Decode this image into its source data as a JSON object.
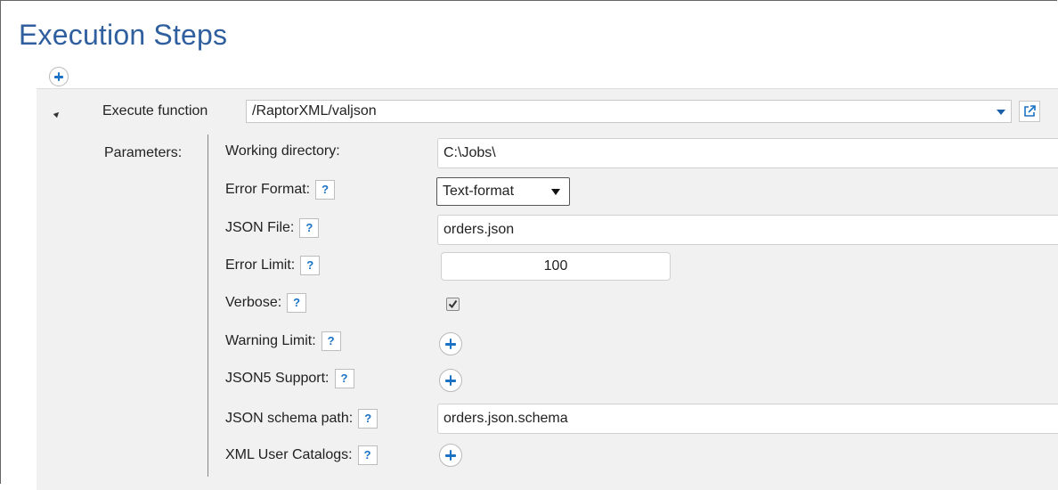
{
  "header": {
    "title": "Execution Steps"
  },
  "step": {
    "execute_label": "Execute function",
    "execute_value": "/RaptorXML/valjson",
    "parameters_label": "Parameters:"
  },
  "params": {
    "working_directory": {
      "label": "Working directory:",
      "value": "C:\\Jobs\\"
    },
    "error_format": {
      "label": "Error Format:",
      "value": "Text-format"
    },
    "json_file": {
      "label": "JSON File:",
      "value": "orders.json"
    },
    "error_limit": {
      "label": "Error Limit:",
      "value": "100"
    },
    "verbose": {
      "label": "Verbose:",
      "checked": true
    },
    "warning_limit": {
      "label": "Warning Limit:"
    },
    "json5_support": {
      "label": "JSON5 Support:"
    },
    "json_schema_path": {
      "label": "JSON schema path:",
      "value": "orders.json.schema"
    },
    "xml_user_catalogs": {
      "label": "XML User Catalogs:"
    }
  },
  "help_label": "?",
  "colors": {
    "title": "#2f5f9e",
    "accent": "#1b72c4",
    "panel": "#f1f1f1"
  }
}
